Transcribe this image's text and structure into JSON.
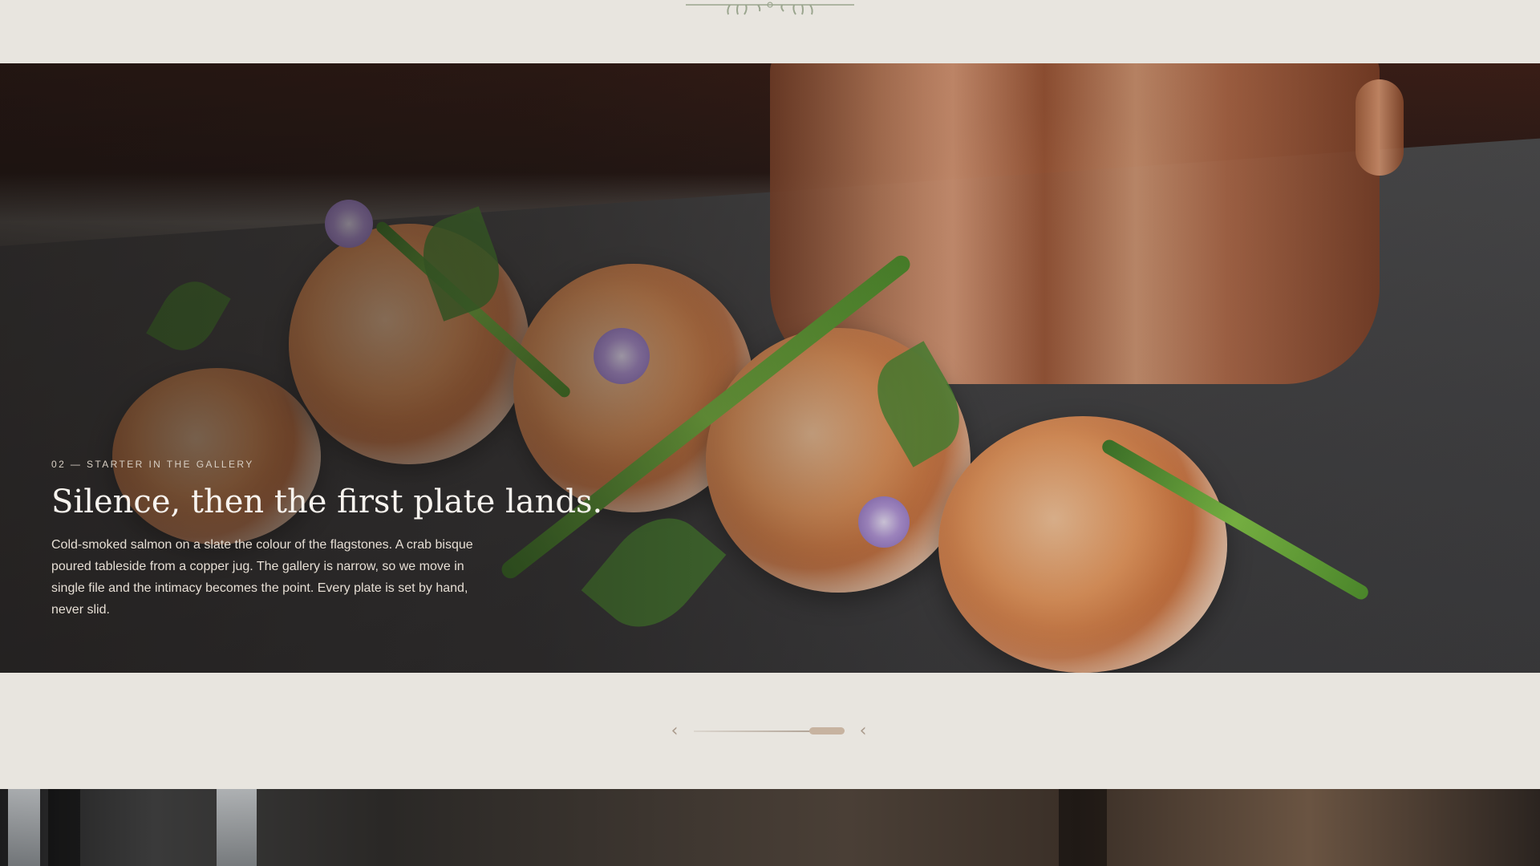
{
  "ornament": {
    "icon": "vine-divider-icon"
  },
  "hero": {
    "eyebrow": "02 — STARTER IN THE GALLERY",
    "headline": "Silence, then the first plate lands.",
    "body": "Cold-smoked salmon on a slate the colour of the flagstones. A crab bisque poured tableside from a copper jug. The gallery is narrow, so we move in single file and the intimacy becomes the point. Every plate is set by hand, never slid."
  },
  "slider": {
    "prev_icon": "‹",
    "next_icon": "‹",
    "prev_icon_name": "chevron-left-icon",
    "next_icon_name": "chevron-left-icon",
    "accent": "#c7b3a0"
  },
  "colors": {
    "page_background": "#e8e5df",
    "headline": "#f7f3ee",
    "eyebrow": "#d8cfc4",
    "ornament": "#9aa58e"
  }
}
